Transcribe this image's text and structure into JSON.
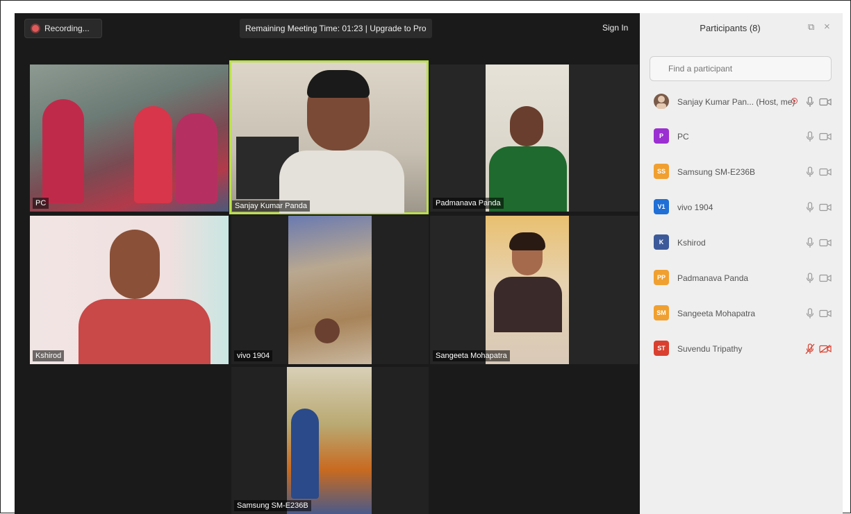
{
  "toolbar": {
    "recording_label": "Recording...",
    "remaining_text": "Remaining Meeting Time: 01:23 | Upgrade to Pro",
    "signin_label": "Sign In"
  },
  "tiles": {
    "pc": "PC",
    "sanjay": "Sanjay Kumar Panda",
    "padmanava": "Padmanava Panda",
    "kshirod": "Kshirod",
    "vivo": "vivo 1904",
    "sangeeta": "Sangeeta Mohapatra",
    "samsung": "Samsung SM-E236B"
  },
  "panel": {
    "title": "Participants (8)",
    "search_placeholder": "Find a participant"
  },
  "participants": [
    {
      "initials": "",
      "name": "Sanjay Kumar Pan... (Host, me)",
      "color": "#7a5a48"
    },
    {
      "initials": "P",
      "name": "PC",
      "color": "#9b2fd1"
    },
    {
      "initials": "SS",
      "name": "Samsung SM-E236B",
      "color": "#f0a030"
    },
    {
      "initials": "V1",
      "name": "vivo 1904",
      "color": "#1f6fd6"
    },
    {
      "initials": "K",
      "name": "Kshirod",
      "color": "#3c5a9a"
    },
    {
      "initials": "PP",
      "name": "Padmanava Panda",
      "color": "#f0a030"
    },
    {
      "initials": "SM",
      "name": "Sangeeta Mohapatra",
      "color": "#f0a030"
    },
    {
      "initials": "ST",
      "name": "Suvendu Tripathy",
      "color": "#d9402f"
    }
  ],
  "colors": {
    "active_speaker": "#b9e04a",
    "muted": "#d9402f"
  }
}
